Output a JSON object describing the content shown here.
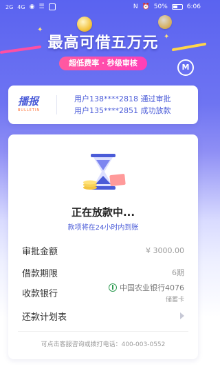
{
  "status_bar": {
    "sim1": "2G",
    "sim2": "4G",
    "right_text": "50%",
    "time": "6:06"
  },
  "banner": {
    "headline": "最高可借五万元",
    "subtitle": "超低费率 · 秒级审核"
  },
  "bulletin": {
    "logo_cn": "播报",
    "logo_en": "BULLETIN",
    "lines": [
      "用户138****2818 通过审批",
      "用户135****2851 成功放款"
    ]
  },
  "loan_status": {
    "title": "正在放款中...",
    "subtitle": "款项将在24小时内到账"
  },
  "details": [
    {
      "label": "审批金额",
      "value": "¥ 3000.00"
    },
    {
      "label": "借款期限",
      "value": "6期"
    },
    {
      "label": "收款银行",
      "value": "中国农业银行4076",
      "sub": "储蓄卡"
    },
    {
      "label": "还款计划表",
      "value": ""
    }
  ],
  "hotline": "可点击客服咨询或拨打电话：400-003-0552",
  "colors": {
    "primary": "#4a5bd8",
    "pink": "#ff3fb7",
    "bank_green": "#2e9b52"
  }
}
